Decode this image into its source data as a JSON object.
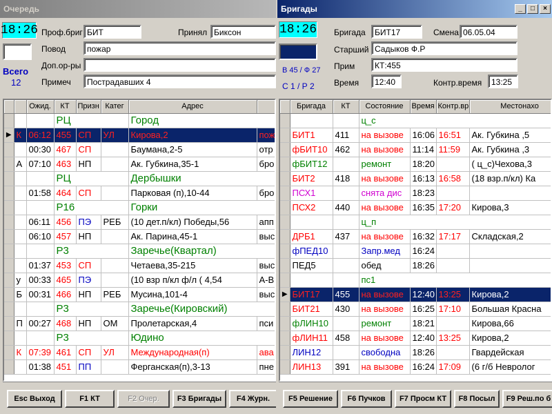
{
  "left": {
    "title": "Очередь",
    "clock": "18:26",
    "total_label": "Всего",
    "total_value": "12",
    "labels": {
      "prof": "Проф.бриг",
      "accepted": "Принял",
      "reason": "Повод",
      "extra": "Доп.ор-ры",
      "note": "Примеч"
    },
    "values": {
      "prof": "БИТ",
      "accepted": "Биксон",
      "reason": "пожар",
      "extra": "",
      "note": "Пострадавших 4"
    },
    "columns": [
      "Ожид.",
      "КТ",
      "Призн",
      "Катег",
      "Адрес",
      ""
    ],
    "rows": [
      {
        "group": true,
        "c1": "РЦ",
        "c4": "Город"
      },
      {
        "mark": "К",
        "wait": "06:12",
        "kt": "455",
        "prizn": "СП",
        "kateg": "УЛ",
        "addr": "Кирова,2",
        "extra": "пож",
        "sel": true,
        "red": true
      },
      {
        "mark": "",
        "wait": "00:30",
        "kt": "467",
        "prizn": "СП",
        "kateg": "",
        "addr": "Баумана,2-5",
        "extra": "отр"
      },
      {
        "mark": "А",
        "wait": "07:10",
        "kt": "463",
        "prizn": "НП",
        "kateg": "",
        "addr": "Ак. Губкина,35-1",
        "extra": "бро"
      },
      {
        "group": true,
        "c1": "РЦ",
        "c4": "Дербышки"
      },
      {
        "mark": "",
        "wait": "01:58",
        "kt": "464",
        "prizn": "СП",
        "kateg": "",
        "addr": "Парковая (п),10-44",
        "extra": "бро"
      },
      {
        "group": true,
        "c1": "Р16",
        "c4": "Горки"
      },
      {
        "mark": "",
        "wait": "06:11",
        "kt": "456",
        "prizn": "ПЭ",
        "kateg": "РЕБ",
        "addr": "(10 дет.п/кл) Победы,56",
        "extra": "апп"
      },
      {
        "mark": "",
        "wait": "06:10",
        "kt": "457",
        "prizn": "НП",
        "kateg": "",
        "addr": "Ак. Парина,45-1",
        "extra": "выс"
      },
      {
        "group": true,
        "c1": "Р3",
        "c4": "Заречье(Квартал)"
      },
      {
        "mark": "",
        "wait": "01:37",
        "kt": "453",
        "prizn": "СП",
        "kateg": "",
        "addr": "Четаева,35-215",
        "extra": "выс"
      },
      {
        "mark": "у",
        "wait": "00:33",
        "kt": "465",
        "prizn": "ПЭ",
        "kateg": "",
        "addr": "(10 взр п/кл ф/л ( 4,54",
        "extra": "А-В"
      },
      {
        "mark": "Б",
        "wait": "00:31",
        "kt": "466",
        "prizn": "НП",
        "kateg": "РЕБ",
        "addr": "Мусина,101-4",
        "extra": "выс"
      },
      {
        "group": true,
        "c1": "Р3",
        "c4": "Заречье(Кировский)"
      },
      {
        "mark": "П",
        "wait": "00:27",
        "kt": "468",
        "prizn": "НП",
        "kateg": "ОМ",
        "addr": "Пролетарская,4",
        "extra": "пси"
      },
      {
        "group": true,
        "c1": "Р3",
        "c4": "Юдино"
      },
      {
        "mark": "К",
        "wait": "07:39",
        "kt": "461",
        "prizn": "СП",
        "kateg": "УЛ",
        "addr": "Международная(п)",
        "extra": "ава",
        "red": true
      },
      {
        "mark": "",
        "wait": "01:38",
        "kt": "451",
        "prizn": "ПП",
        "kateg": "",
        "addr": "Ферганская(п),3-13",
        "extra": "пне"
      }
    ],
    "buttons": [
      "Esc Выход",
      "F1   КТ",
      "F2 Очер.",
      "F3 Бригады",
      "F4 Журн."
    ]
  },
  "right": {
    "title": "Бригады",
    "clock": "18:26",
    "status1": "В 45 / Ф 27",
    "status2": "С 1   / Р 2",
    "labels": {
      "brig": "Бригада",
      "shift": "Смена",
      "senior": "Старший",
      "arrived": "Прим",
      "time": "Время",
      "ctrl": "Контр.время"
    },
    "values": {
      "brig": "БИТ17",
      "shift": "06.05.04",
      "senior": "Садыков Ф.Р",
      "arrived": "КТ:455",
      "time": "12:40",
      "ctrl": "13:25"
    },
    "columns": [
      "Бригада",
      "КТ",
      "Состояние",
      "Время",
      "Контр.вр",
      "Местонахо"
    ],
    "rows": [
      {
        "group": true,
        "state": "ц_с"
      },
      {
        "brig": "БИТ1",
        "bc": "red",
        "kt": "411",
        "state": "на вызове",
        "sc": "red",
        "time": "16:06",
        "ctrl": "16:51",
        "loc": "Ак. Губкина   ,5"
      },
      {
        "brig": "фБИТ10",
        "bc": "red",
        "kt": "462",
        "state": "на вызове",
        "sc": "red",
        "time": "11:14",
        "ctrl": "11:59",
        "loc": "Ак. Губкина   ,3"
      },
      {
        "brig": "фБИТ12",
        "bc": "green",
        "kt": "",
        "state": "ремонт",
        "sc": "green",
        "time": "18:20",
        "ctrl": "",
        "loc": "( ц_с)Чехова,3"
      },
      {
        "brig": "БИТ2",
        "bc": "red",
        "kt": "418",
        "state": "на вызове",
        "sc": "red",
        "time": "16:13",
        "ctrl": "16:58",
        "loc": "(18 взр.п/кл) Ка"
      },
      {
        "brig": "ПСХ1",
        "bc": "mag",
        "kt": "",
        "state": "снята дис",
        "sc": "mag",
        "time": "18:23",
        "ctrl": "",
        "loc": ""
      },
      {
        "brig": "ПСХ2",
        "bc": "red",
        "kt": "440",
        "state": "на вызове",
        "sc": "red",
        "time": "16:35",
        "ctrl": "17:20",
        "loc": "Кирова,3"
      },
      {
        "group": true,
        "state": "ц_п"
      },
      {
        "brig": "ДРБ1",
        "bc": "red",
        "kt": "437",
        "state": "на вызове",
        "sc": "red",
        "time": "16:32",
        "ctrl": "17:17",
        "loc": "Складская,2"
      },
      {
        "brig": "фПЕД10",
        "bc": "blue",
        "kt": "",
        "state": "Запр.мед",
        "sc": "blue",
        "time": "16:24",
        "ctrl": "",
        "loc": ""
      },
      {
        "brig": "ПЕД5",
        "bc": "black",
        "kt": "",
        "state": "обед",
        "sc": "black",
        "time": "18:26",
        "ctrl": "",
        "loc": ""
      },
      {
        "group": true,
        "state": "пс1"
      },
      {
        "brig": "БИТ17",
        "bc": "red",
        "kt": "455",
        "state": "на вызове",
        "sc": "red",
        "time": "12:40",
        "ctrl": "13:25",
        "loc": "Кирова,2",
        "sel": true
      },
      {
        "brig": "БИТ21",
        "bc": "red",
        "kt": "430",
        "state": "на вызове",
        "sc": "red",
        "time": "16:25",
        "ctrl": "17:10",
        "loc": "Большая Красна"
      },
      {
        "brig": "фЛИН10",
        "bc": "green",
        "kt": "",
        "state": "ремонт",
        "sc": "green",
        "time": "18:21",
        "ctrl": "",
        "loc": "Кирова,66"
      },
      {
        "brig": "фЛИН11",
        "bc": "red",
        "kt": "458",
        "state": "на вызове",
        "sc": "red",
        "time": "12:40",
        "ctrl": "13:25",
        "loc": "Кирова,2"
      },
      {
        "brig": "ЛИН12",
        "bc": "blue",
        "kt": "",
        "state": "свободна",
        "sc": "blue",
        "time": "18:26",
        "ctrl": "",
        "loc": "Гвардейская"
      },
      {
        "brig": "ЛИН13",
        "bc": "red",
        "kt": "391",
        "state": "на вызове",
        "sc": "red",
        "time": "16:24",
        "ctrl": "17:09",
        "loc": "(6 г/б Невролог"
      }
    ],
    "buttons": [
      "F5 Решение",
      "F6 Пучков",
      "F7 Просм КТ",
      "F8 Посыл",
      "F9 Реш.по б"
    ]
  }
}
